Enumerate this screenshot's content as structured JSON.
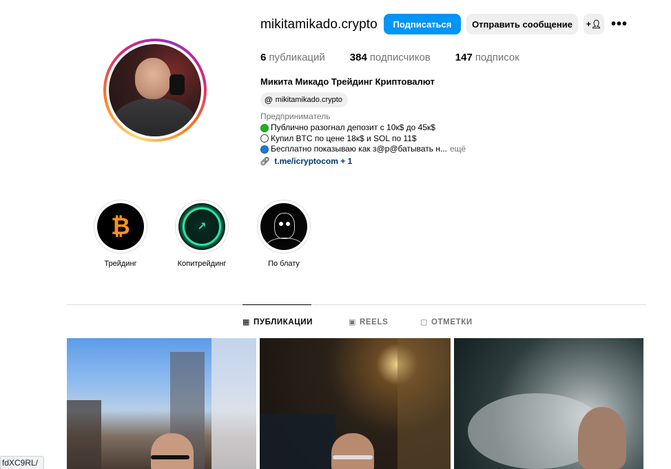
{
  "profile": {
    "username": "mikitamikado.crypto",
    "follow_button": "Подписаться",
    "message_button": "Отправить сообщение",
    "add_user_icon": "+person-icon",
    "more_glyph": "•••",
    "stats": {
      "posts_count": "6",
      "posts_label": "публикаций",
      "followers_count": "384",
      "followers_label": "подписчиков",
      "following_count": "147",
      "following_label": "подписок"
    },
    "full_name": "Микита Микадо Трейдинг Криптовалют",
    "threads_handle": "mikitamikado.crypto",
    "category": "Предприниматель",
    "bio_lines": [
      "Публично разогнал депозит с 10к$ до 45к$",
      "Купил BTC по цене 18к$ и SOL по 11$",
      "Бесплатно показываю как з@р@батывать н..."
    ],
    "bio_more": "ещё",
    "link_text": "t.me/icryptocom + 1"
  },
  "highlights": [
    {
      "label": "Трейдинг",
      "icon": "bitcoin-icon"
    },
    {
      "label": "Копитрейдинг",
      "icon": "copytrading-icon"
    },
    {
      "label": "По блату",
      "icon": "masked-person-icon"
    }
  ],
  "tabs": [
    {
      "label": "ПУБЛИКАЦИИ",
      "icon": "grid-icon",
      "active": true
    },
    {
      "label": "REELS",
      "icon": "reels-icon",
      "active": false
    },
    {
      "label": "ОТМЕТКИ",
      "icon": "tagged-icon",
      "active": false
    }
  ],
  "status_url": "fdXC9RL/",
  "colors": {
    "accent": "#0095f6",
    "link": "#00376b",
    "secondary_text": "#737373"
  }
}
